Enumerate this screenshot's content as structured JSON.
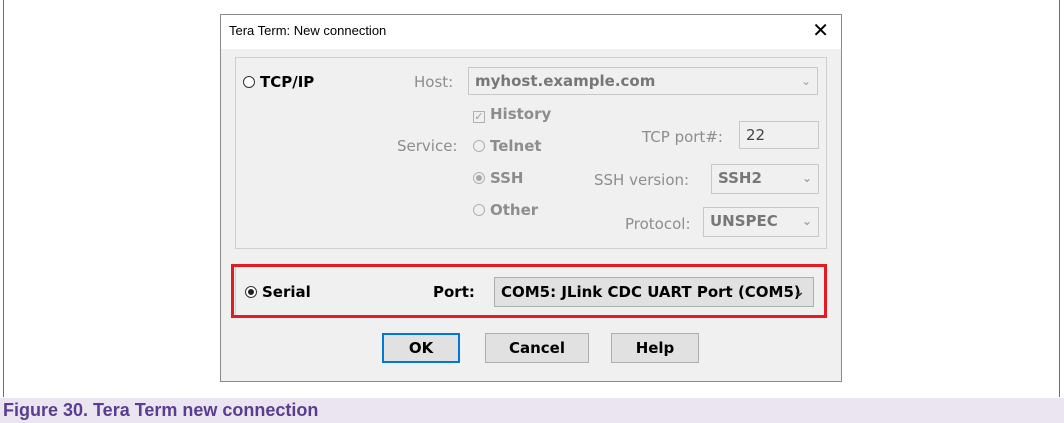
{
  "dialog": {
    "title": "Tera Term: New connection",
    "close_glyph": "✕"
  },
  "tcpip": {
    "radio_label": "TCP/IP",
    "selected": false,
    "host_label": "Host:",
    "host_value": "myhost.example.com",
    "history_label": "History",
    "history_checked": true,
    "service_label": "Service:",
    "services": [
      "Telnet",
      "SSH",
      "Other"
    ],
    "selected_service": "SSH",
    "tcp_port_label": "TCP port#:",
    "tcp_port_value": "22",
    "ssh_version_label": "SSH version:",
    "ssh_version_value": "SSH2",
    "protocol_label": "Protocol:",
    "protocol_value": "UNSPEC"
  },
  "serial": {
    "radio_label": "Serial",
    "selected": true,
    "port_label": "Port:",
    "port_value": "COM5: JLink CDC UART Port (COM5)"
  },
  "buttons": {
    "ok": "OK",
    "cancel": "Cancel",
    "help": "Help"
  },
  "caption": "Figure 30.  Tera Term new connection",
  "colors": {
    "highlight_border": "#e31b23",
    "caption_text": "#5b3d8f",
    "caption_bg": "#ebe4f1",
    "default_button_border": "#0078d7"
  },
  "icons": {
    "close": "close-icon",
    "dropdown": "chevron-down-icon"
  }
}
